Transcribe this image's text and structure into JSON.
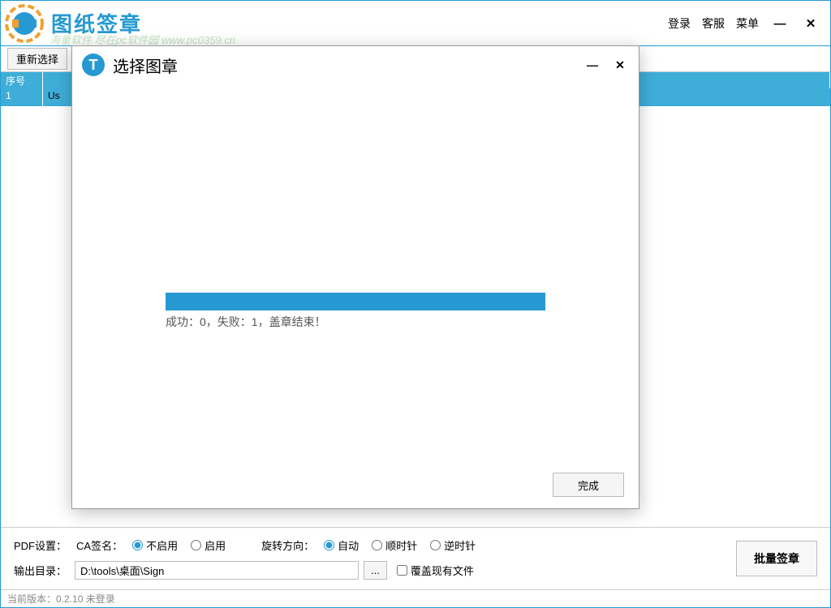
{
  "app": {
    "title": "图纸签章",
    "watermark": "海量软件 尽在pc软件园 www.pc0359.cn"
  },
  "titlebar": {
    "login": "登录",
    "service": "客服",
    "menu": "菜单"
  },
  "toolbar": {
    "reselect": "重新选择"
  },
  "table": {
    "header_seq": "序号",
    "row1_seq": "1",
    "row1_path": "Us"
  },
  "modal": {
    "title": "选择图章",
    "progress_text": "成功：0，失败：1，盖章结束！",
    "complete": "完成"
  },
  "settings": {
    "pdf_label": "PDF设置：",
    "ca_label": "CA签名：",
    "ca_disable": "不启用",
    "ca_enable": "启用",
    "rotate_label": "旋转方向：",
    "rotate_auto": "自动",
    "rotate_cw": "顺时针",
    "rotate_ccw": "逆时针",
    "output_label": "输出目录：",
    "output_path": "D:\\tools\\桌面\\Sign",
    "browse": "...",
    "overwrite": "覆盖现有文件",
    "batch_sign": "批量签章"
  },
  "status": {
    "version": "当前版本：0.2.10 未登录"
  }
}
